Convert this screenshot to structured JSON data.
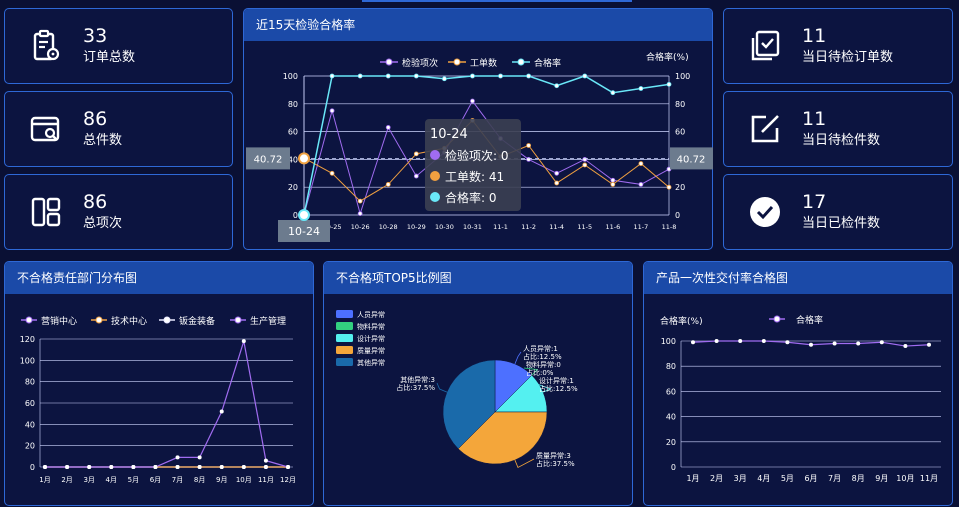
{
  "stats": [
    {
      "value": "33",
      "label": "订单总数",
      "icon": "clipboard-icon"
    },
    {
      "value": "86",
      "label": "总件数",
      "icon": "card-search-icon"
    },
    {
      "value": "86",
      "label": "总项次",
      "icon": "grid-layout-icon"
    },
    {
      "value": "11",
      "label": "当日待检订单数",
      "icon": "checklist-icon"
    },
    {
      "value": "11",
      "label": "当日待检件数",
      "icon": "edit-square-icon"
    },
    {
      "value": "17",
      "label": "当日已检件数",
      "icon": "check-circle-icon"
    }
  ],
  "colors": {
    "purple": "#a06cf0",
    "orange": "#f0a040",
    "cyan": "#6ae8f8",
    "white": "#e8e8ff",
    "blue": "#4d70ff",
    "green": "#32d080",
    "cyan2": "#54f0f0",
    "orange2": "#f4a63a",
    "darkblue": "#1a6aaa"
  },
  "chart_data": [
    {
      "type": "line",
      "title": "近15天检验合格率",
      "ylabel_right": "合格率(%)",
      "x": [
        "10-24",
        "10-25",
        "10-26",
        "10-28",
        "10-29",
        "10-30",
        "10-31",
        "11-1",
        "11-2",
        "11-4",
        "11-5",
        "11-6",
        "11-7",
        "11-8"
      ],
      "ylim": [
        0,
        100
      ],
      "ylim_right": [
        0,
        100
      ],
      "yticks": [
        0,
        20,
        40,
        60,
        80,
        100
      ],
      "series": [
        {
          "name": "检验项次",
          "axis": "left",
          "values": [
            0,
            75,
            1,
            63,
            28,
            45,
            82,
            55,
            40,
            30,
            40,
            25,
            22,
            33
          ]
        },
        {
          "name": "工单数",
          "axis": "left",
          "values": [
            41,
            30,
            10,
            22,
            44,
            48,
            68,
            42,
            50,
            23,
            36,
            22,
            37,
            20
          ]
        },
        {
          "name": "合格率",
          "axis": "right",
          "values": [
            0,
            100,
            100,
            100,
            100,
            98,
            100,
            100,
            100,
            93,
            100,
            88,
            91,
            94
          ]
        }
      ],
      "crosshair": {
        "value_label": "40.72",
        "x_label": "10-24"
      },
      "tooltip": {
        "title": "10-24",
        "rows": [
          {
            "name": "检验项次",
            "value": "0"
          },
          {
            "name": "工单数",
            "value": "41"
          },
          {
            "name": "合格率",
            "value": "0"
          }
        ]
      }
    },
    {
      "type": "line",
      "title": "不合格责任部门分布图",
      "x": [
        "1月",
        "2月",
        "3月",
        "4月",
        "5月",
        "6月",
        "7月",
        "8月",
        "9月",
        "10月",
        "11月",
        "12月"
      ],
      "ylim": [
        0,
        120
      ],
      "yticks": [
        0,
        20,
        40,
        60,
        80,
        100,
        120
      ],
      "series": [
        {
          "name": "营销中心",
          "values": [
            0,
            0,
            0,
            0,
            0,
            0,
            9,
            9,
            52,
            118,
            6,
            0
          ]
        },
        {
          "name": "技术中心",
          "values": [
            0,
            0,
            0,
            0,
            0,
            0,
            0,
            0,
            0,
            0,
            0,
            0
          ]
        },
        {
          "name": "钣金装备",
          "values": [
            0,
            0,
            0,
            0,
            0,
            0,
            0,
            0,
            0,
            0,
            0,
            0
          ]
        },
        {
          "name": "生产管理",
          "values": [
            0,
            0,
            0,
            0,
            0,
            0,
            0,
            0,
            0,
            0,
            0,
            0
          ]
        }
      ]
    },
    {
      "type": "pie",
      "title": "不合格项TOP5比例图",
      "slices": [
        {
          "name": "人员异常",
          "value": 1,
          "label1": "人员异常:1",
          "label2": "占比:12.5%"
        },
        {
          "name": "物料异常",
          "value": 0,
          "label1": "物料异常:0",
          "label2": "占比:0%"
        },
        {
          "name": "设计异常",
          "value": 1,
          "label1": "设计异常:1",
          "label2": "占比:12.5%"
        },
        {
          "name": "质量异常",
          "value": 3,
          "label1": "质量异常:3",
          "label2": "占比:37.5%"
        },
        {
          "name": "其他异常",
          "value": 3,
          "label1": "其他异常:3",
          "label2": "占比:37.5%"
        }
      ]
    },
    {
      "type": "line",
      "title": "产品一次性交付率合格图",
      "ylabel": "合格率(%)",
      "x": [
        "1月",
        "2月",
        "3月",
        "4月",
        "5月",
        "6月",
        "7月",
        "8月",
        "9月",
        "10月",
        "11月"
      ],
      "ylim": [
        0,
        100
      ],
      "yticks": [
        0,
        20,
        40,
        60,
        80,
        100
      ],
      "series": [
        {
          "name": "合格率",
          "values": [
            99,
            100,
            100,
            100,
            99,
            97,
            98,
            98,
            99,
            96,
            97
          ]
        }
      ]
    }
  ]
}
